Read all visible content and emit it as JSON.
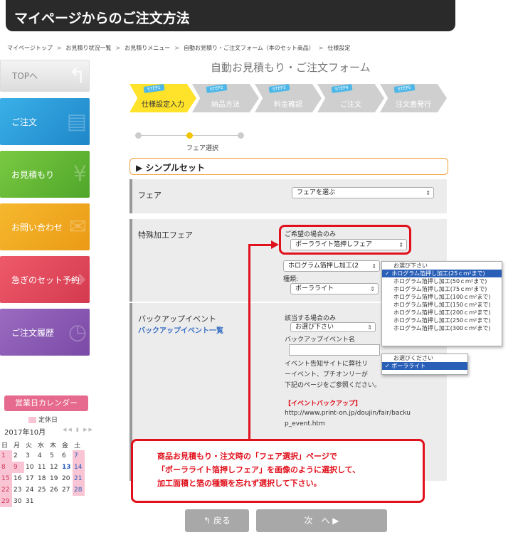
{
  "page_title": "マイページからのご注文方法",
  "breadcrumb": [
    "マイページトップ",
    "お見積り状況一覧",
    "お見積りメニュー",
    "自動お見積り・ご注文フォーム（本のセット商品）",
    "仕様設定"
  ],
  "breadcrumb_sep": ">",
  "sidebar": {
    "top": "TOPへ",
    "order": "ご注文",
    "estimate": "お見積もり",
    "contact": "お問い合わせ",
    "rush": "急ぎのセット予約",
    "history": "ご注文履歴"
  },
  "calendar": {
    "title": "営業日カレンダー",
    "legend": "定休日",
    "month": "2017年10月",
    "weekdays": [
      "日",
      "月",
      "火",
      "水",
      "木",
      "金",
      "土"
    ],
    "weeks": [
      [
        "1",
        "2",
        "3",
        "4",
        "5",
        "6",
        "7"
      ],
      [
        "8",
        "9",
        "10",
        "11",
        "12",
        "13",
        "14"
      ],
      [
        "15",
        "16",
        "17",
        "18",
        "19",
        "20",
        "21"
      ],
      [
        "22",
        "23",
        "24",
        "25",
        "26",
        "27",
        "28"
      ],
      [
        "29",
        "30",
        "31",
        "",
        "",
        "",
        ""
      ]
    ]
  },
  "form": {
    "title": "自動お見積もり・ご注文フォーム",
    "steps": [
      {
        "tag": "STEP1",
        "label": "仕様設定入力"
      },
      {
        "tag": "STEP2",
        "label": "納品方法"
      },
      {
        "tag": "STEP3",
        "label": "料金確認"
      },
      {
        "tag": "STEP4",
        "label": "ご注文"
      },
      {
        "tag": "STEP5",
        "label": "注文書発行"
      }
    ],
    "substep_label": "フェア選択",
    "section_title": "シンプルセット",
    "fair_label": "フェア",
    "fair_select": "フェアを選ぶ",
    "special_label": "特殊加工フェア",
    "special_hint": "ご希望の場合のみ",
    "special_select": "ポーラライト箔押しフェア",
    "hologram_select": "ホログラム箔押し加工(2",
    "kind_label": "種類:",
    "kind_select": "ポーラライト",
    "backup_label": "バックアップイベント",
    "backup_link": "バックアップイベント一覧",
    "backup_hint": "該当する場合のみ",
    "backup_select": "お選び下さい",
    "backup_event_name": "バックアップイベント名",
    "event_text1": "イベント告知サイトに弊社リ",
    "event_text2": "ーイベント、プチオンリーが",
    "event_text3": "下記のページをご参照ください。",
    "event_link_title": "【イベントバックアップ】",
    "event_url1": "http://www.print-on.jp/doujin/fair/backu",
    "event_url2": "p_event.htm"
  },
  "dropdown_area": {
    "header": "お選び下さい",
    "options": [
      "ホログラム箔押し加工(25ｃｍ²まで)",
      "ホログラム箔押し加工(50ｃｍ²まで)",
      "ホログラム箔押し加工(75ｃｍ²まで)",
      "ホログラム箔押し加工(100ｃｍ²まで)",
      "ホログラム箔押し加工(150ｃｍ²まで)",
      "ホログラム箔押し加工(200ｃｍ²まで)",
      "ホログラム箔押し加工(250ｃｍ²まで)",
      "ホログラム箔押し加工(300ｃｍ²まで)"
    ]
  },
  "dropdown_kind": {
    "header": "お選びください",
    "options": [
      "ポーラライト"
    ]
  },
  "note": [
    "商品お見積もり・注文時の「フェア選択」ページで",
    "「ポーラライト箔押しフェア」を画像のように選択して、",
    "加工面積と箔の種類を忘れず選択して下さい。"
  ],
  "buttons": {
    "back": "戻る",
    "next": "次　へ"
  },
  "colors": {
    "highlight_red": "#e0101c",
    "active_step": "#ffe32a",
    "selected_option": "#2a5fb8"
  }
}
